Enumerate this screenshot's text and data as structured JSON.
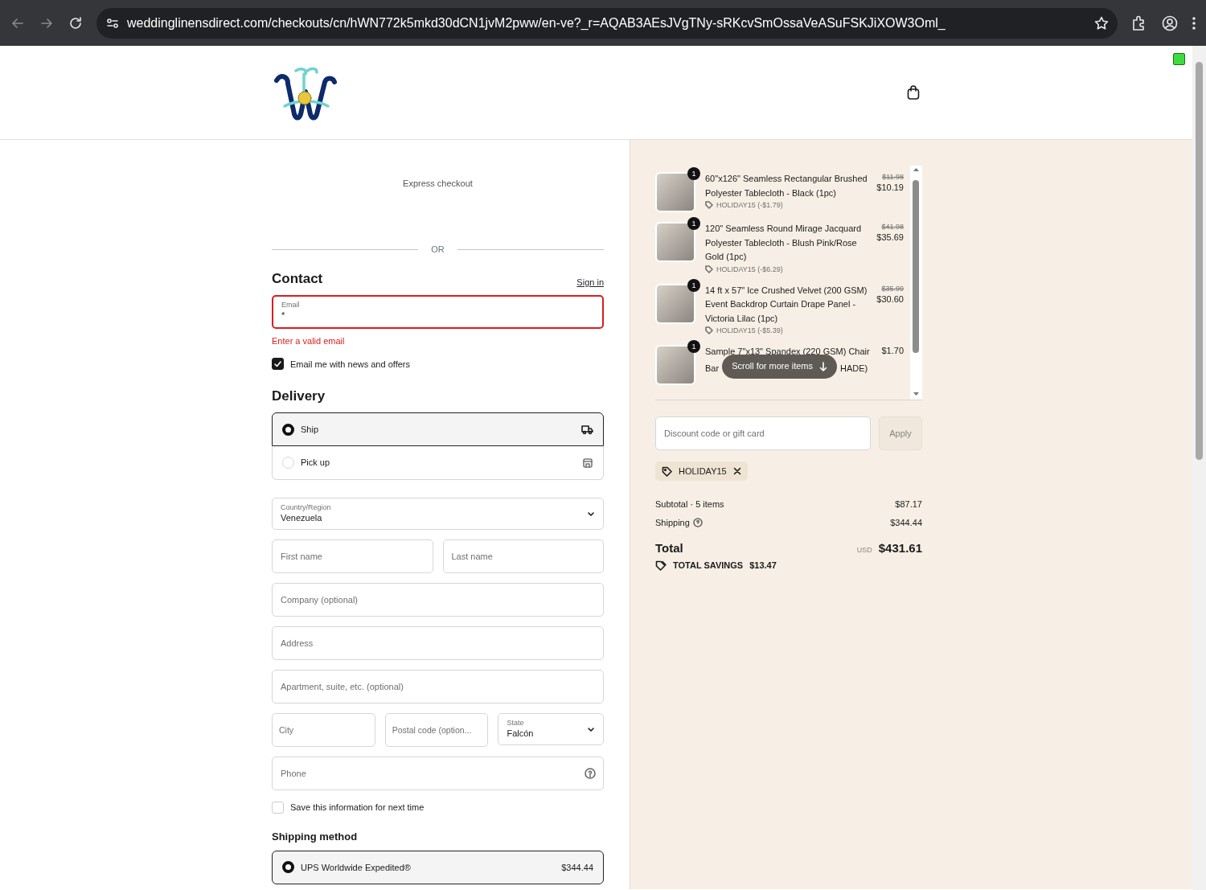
{
  "browser": {
    "url": "weddinglinensdirect.com/checkouts/cn/hWN772k5mkd30dCN1jvM2pww/en-ve?_r=AQAB3AEsJVgTNy-sRKcvSmOssaVeASuFSKJiXOW3Oml_"
  },
  "express_checkout": {
    "label": "Express checkout",
    "divider": "OR"
  },
  "contact": {
    "title": "Contact",
    "sign_in": "Sign in",
    "email": {
      "label": "Email",
      "value": "*",
      "invalid": true,
      "error": "Enter a valid email"
    },
    "newsletter": {
      "label": "Email me with news and offers",
      "checked": true
    }
  },
  "delivery": {
    "title": "Delivery",
    "options": [
      {
        "kind": "ship",
        "label": "Ship",
        "selected": true
      },
      {
        "kind": "pickup",
        "label": "Pick up",
        "selected": false
      }
    ],
    "field_rows": [
      [
        {
          "kind": "select",
          "label": "Country/Region",
          "value": "Venezuela"
        }
      ],
      [
        {
          "kind": "input",
          "placeholder": "First name"
        },
        {
          "kind": "input",
          "placeholder": "Last name"
        }
      ],
      [
        {
          "kind": "input",
          "placeholder": "Company (optional)"
        }
      ],
      [
        {
          "kind": "input",
          "placeholder": "Address"
        }
      ],
      [
        {
          "kind": "input",
          "placeholder": "Apartment, suite, etc. (optional)"
        }
      ],
      [
        {
          "kind": "input",
          "placeholder": "City"
        },
        {
          "kind": "input",
          "placeholder": "Postal code (option..."
        },
        {
          "kind": "select",
          "label": "State",
          "value": "Falcón"
        }
      ],
      [
        {
          "kind": "help",
          "placeholder": "Phone"
        }
      ]
    ],
    "save_info": {
      "label": "Save this information for next time",
      "checked": false
    }
  },
  "shipping_method": {
    "title": "Shipping method",
    "options": [
      {
        "name": "UPS Worldwide Expedited®",
        "price": "$344.44",
        "selected": true
      }
    ]
  },
  "order": {
    "items": [
      {
        "quantity": "1",
        "name": "60\"x126\" Seamless Rectangular Brushed Polyester Tablecloth - Black (1pc)",
        "original_price": "$11.98",
        "price": "$10.19",
        "discount": "HOLIDAY15 (-$1.79)"
      },
      {
        "quantity": "1",
        "name": "120\" Seamless Round Mirage Jacquard Polyester Tablecloth - Blush Pink/Rose Gold (1pc)",
        "original_price": "$41.98",
        "price": "$35.69",
        "discount": "HOLIDAY15 (-$6.29)"
      },
      {
        "quantity": "1",
        "name": "14 ft x 57\" Ice Crushed Velvet (200 GSM) Event Backdrop Curtain Drape Panel - Victoria Lilac (1pc)",
        "original_price": "$35.99",
        "price": "$30.60",
        "discount": "HOLIDAY15 (-$5.39)"
      },
      {
        "quantity": "1",
        "name": "Sample 7\"x13\" Spandex (220 GSM) Chair",
        "name_tail": [
          "Bar",
          "HADE)"
        ],
        "price": "$1.70"
      }
    ],
    "scroll_hint": "Scroll for more items",
    "discount_placeholder": "Discount code or gift card",
    "apply": "Apply",
    "applied_code": "HOLIDAY15",
    "subtotal_label": "Subtotal · 5 items",
    "subtotal": "$87.17",
    "shipping_label": "Shipping",
    "shipping": "$344.44",
    "total_label": "Total",
    "currency": "USD",
    "total": "$431.61",
    "savings_label": "TOTAL SAVINGS",
    "savings": "$13.47"
  }
}
